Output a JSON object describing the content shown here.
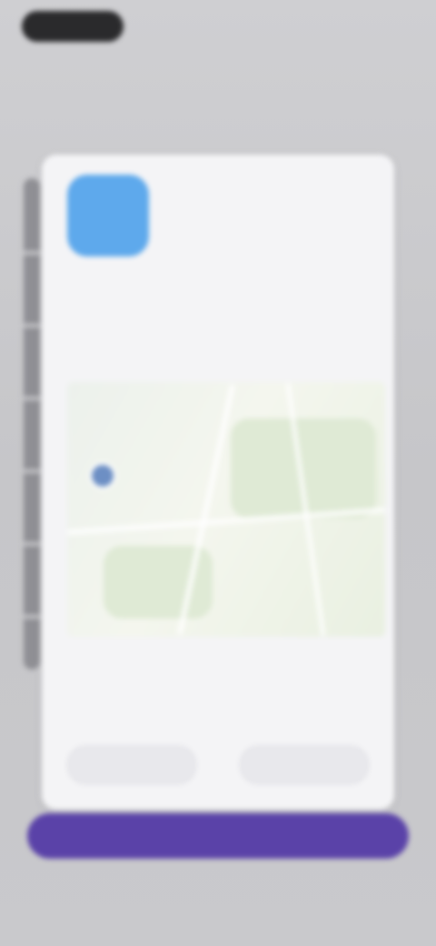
{
  "header": {
    "title": "",
    "subtitle": ""
  },
  "card": {
    "title": "",
    "description": "",
    "location_text": "",
    "buttons": {
      "left_label": "",
      "right_label": ""
    }
  },
  "footer": {
    "primary_label": "",
    "secondary_label": ""
  },
  "colors": {
    "primary": "#5a42a8",
    "app_icon": "#5ea9ec",
    "map_pin": "#6d8fc4"
  },
  "icons": {
    "app": "app-icon",
    "map_marker": "map-pin-icon"
  }
}
